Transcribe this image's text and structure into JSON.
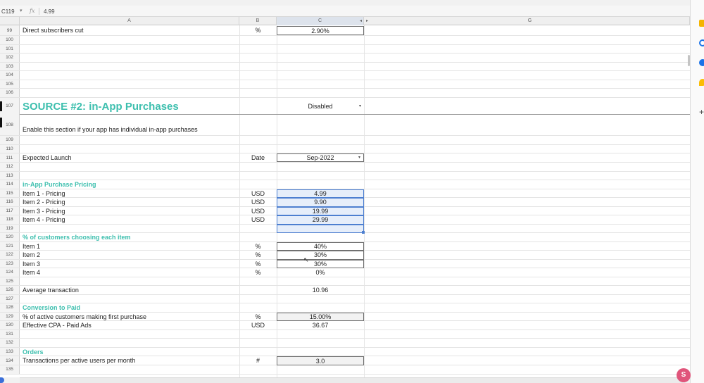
{
  "formula_bar": {
    "cell_ref": "C119",
    "fx": "fx",
    "value": "4.99"
  },
  "columns": [
    "A",
    "B",
    "C",
    "G"
  ],
  "empty_rows": [
    "100",
    "101",
    "102",
    "103",
    "104",
    "105",
    "106",
    "109",
    "110",
    "112",
    "113",
    "119",
    "125",
    "127",
    "131",
    "132",
    "135"
  ],
  "rows": {
    "r99": {
      "num": "99",
      "label": "Direct subscribers cut",
      "unit": "%",
      "value": "2.90%"
    },
    "r107": {
      "num": "107",
      "title": "SOURCE #2: in-App Purchases",
      "dropdown": "Disabled"
    },
    "r108": {
      "num": "108",
      "label": "Enable this section if your app has individual in-app purchases"
    },
    "r111": {
      "num": "111",
      "label": "Expected Launch",
      "unit": "Date",
      "dropdown": "Sep-2022"
    },
    "r114": {
      "num": "114",
      "heading": "in-App Purchase Pricing"
    },
    "r115": {
      "num": "115",
      "label": "Item 1 - Pricing",
      "unit": "USD",
      "value": "4.99"
    },
    "r116": {
      "num": "116",
      "label": "Item 2 - Pricing",
      "unit": "USD",
      "value": "9.90"
    },
    "r117": {
      "num": "117",
      "label": "Item 3 - Pricing",
      "unit": "USD",
      "value": "19.99"
    },
    "r118": {
      "num": "118",
      "label": "Item 4 - Pricing",
      "unit": "USD",
      "value": "29.99"
    },
    "r120": {
      "num": "120",
      "heading": "% of customers choosing each item"
    },
    "r121": {
      "num": "121",
      "label": "Item 1",
      "unit": "%",
      "value": "40%"
    },
    "r122": {
      "num": "122",
      "label": "Item 2",
      "unit": "%",
      "value": "30%"
    },
    "r123": {
      "num": "123",
      "label": "Item 3",
      "unit": "%",
      "value": "30%"
    },
    "r124": {
      "num": "124",
      "label": "Item 4",
      "unit": "%",
      "value": "0%"
    },
    "r126": {
      "num": "126",
      "label": "Average transaction",
      "value": "10.96"
    },
    "r128": {
      "num": "128",
      "heading": "Conversion to Paid"
    },
    "r129": {
      "num": "129",
      "label": "% of active customers making first purchase",
      "unit": "%",
      "value": "15.00%"
    },
    "r130": {
      "num": "130",
      "label": "Effective CPA - Paid Ads",
      "unit": "USD",
      "value": "36.67"
    },
    "r133": {
      "num": "133",
      "heading": "Orders"
    },
    "r134": {
      "num": "134",
      "label": "Transactions per active users per month",
      "unit": "#",
      "value": "3.0"
    }
  },
  "right_panel": {
    "icons": [
      "calendar-icon",
      "keep-icon",
      "contacts-icon",
      "maps-icon",
      "add-icon"
    ],
    "plus": "+"
  },
  "avatar": "S",
  "colors": {
    "heading": "#3dbfae",
    "selection": "#4d7fd0",
    "avatar": "#e0557b"
  }
}
